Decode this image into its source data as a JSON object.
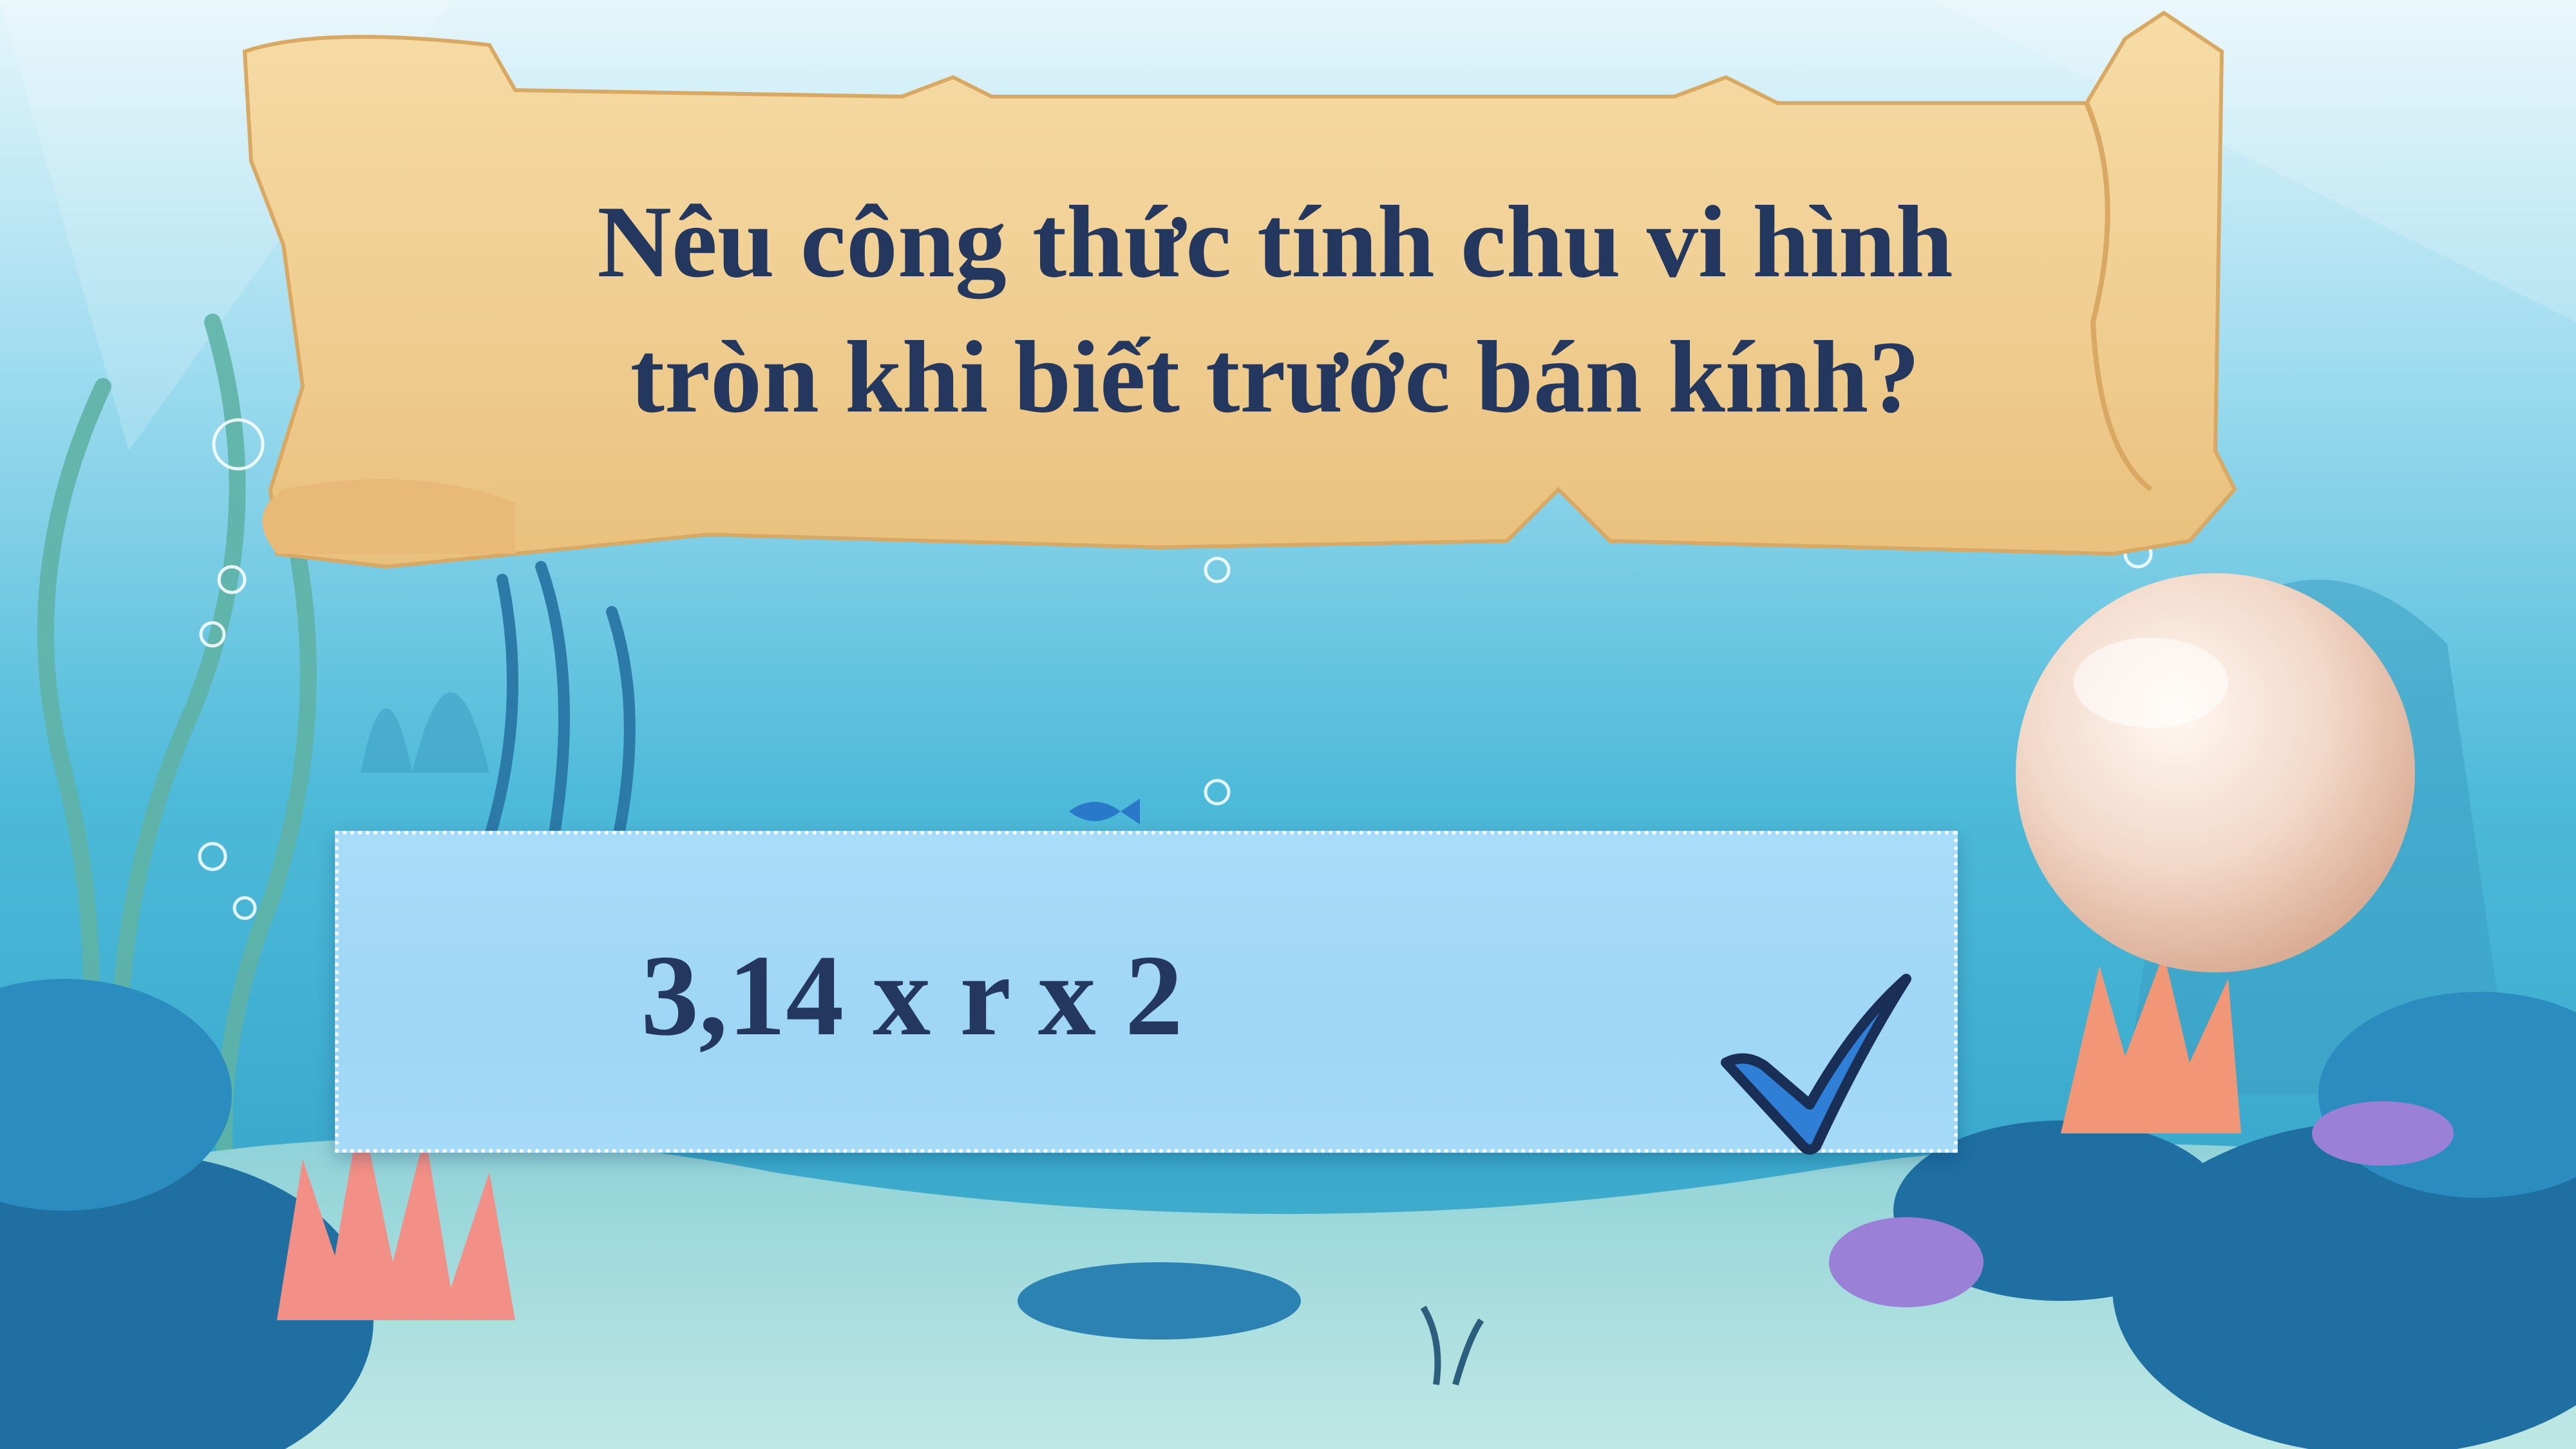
{
  "question": {
    "line1": "Nêu công thức tính chu vi hình",
    "line2": "tròn khi biết trước bán kính?"
  },
  "answer": {
    "text": "3,14 x r x 2",
    "status_icon": "checkmark-icon"
  },
  "colors": {
    "text": "#24385f",
    "water_top": "#e8f6fb",
    "water_mid": "#59c2e0",
    "answer_box": "#a9dcf8",
    "scroll": "#f2d39a",
    "checkmark": "#2f7fd6"
  }
}
